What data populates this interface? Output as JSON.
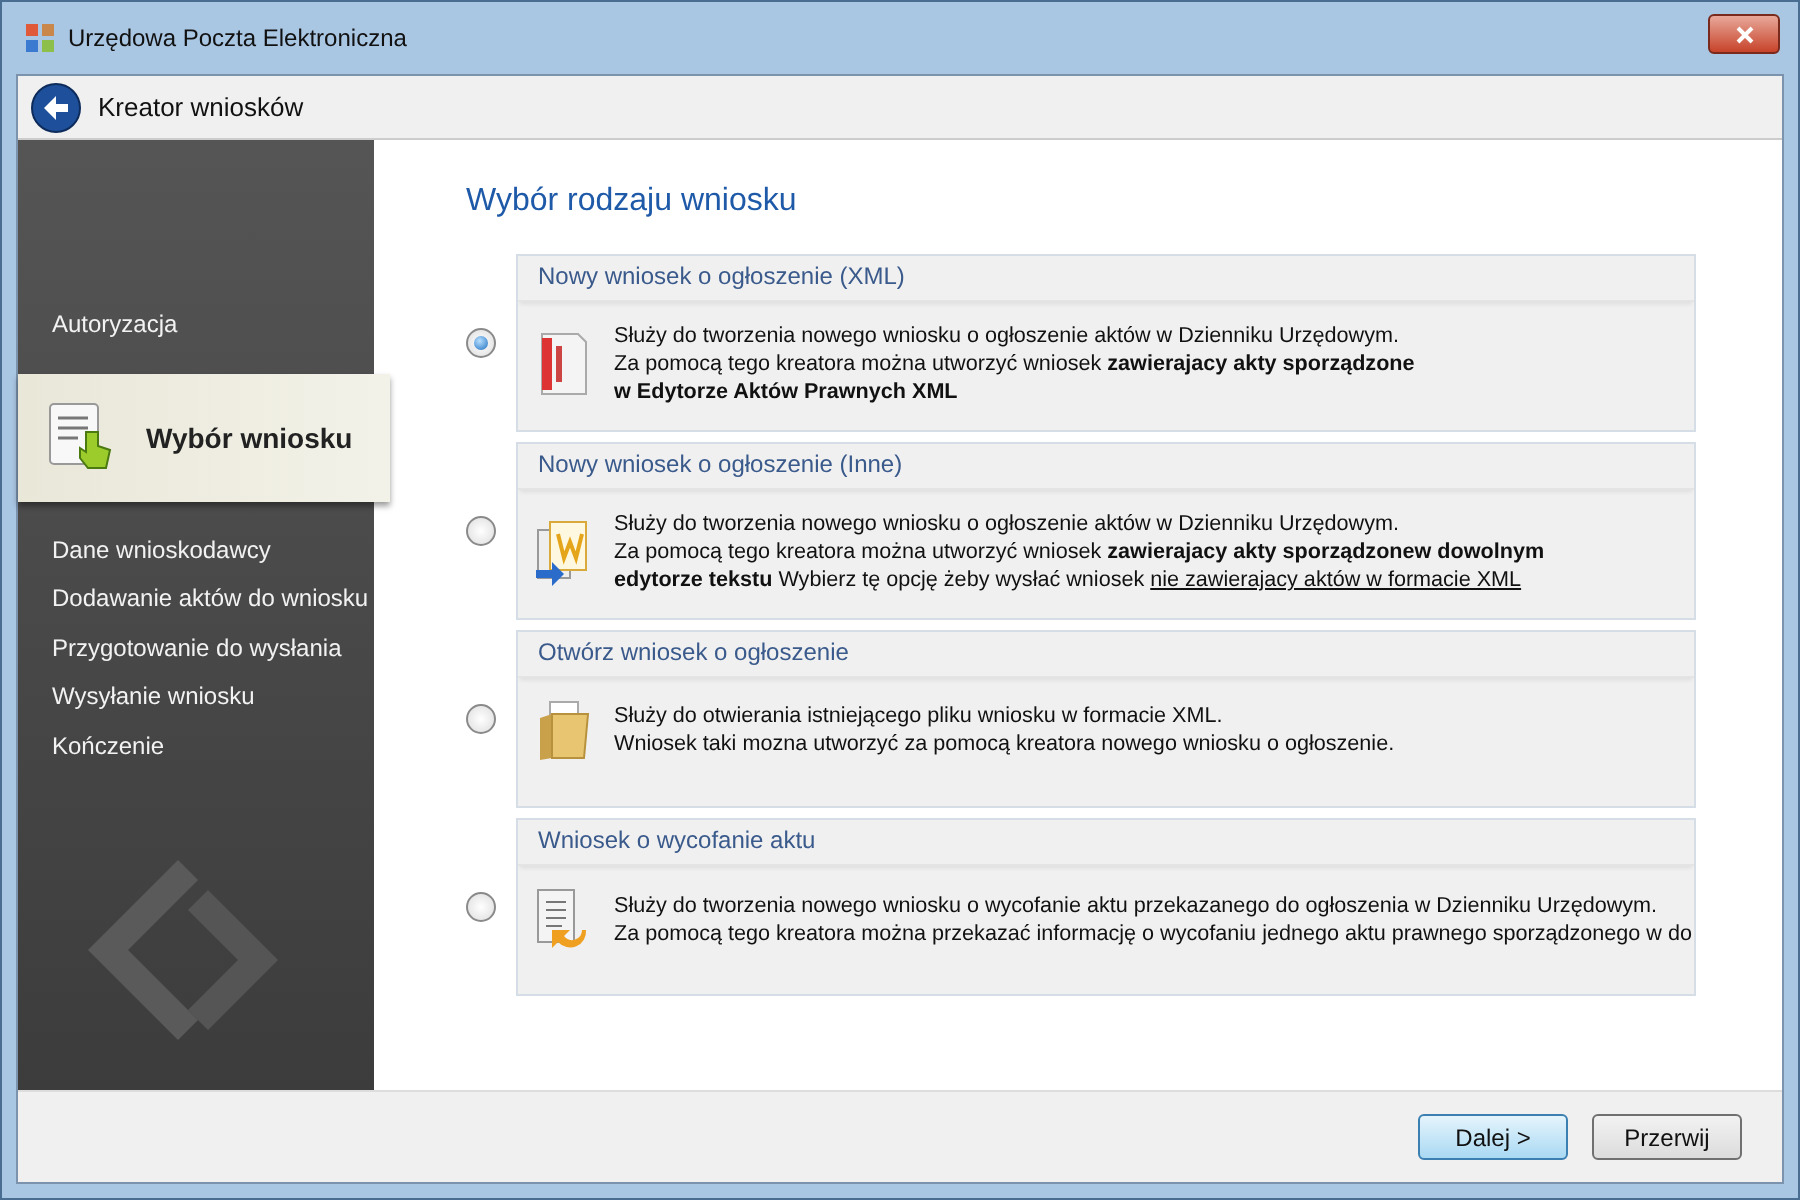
{
  "window": {
    "title": "Urzędowa Poczta Elektroniczna"
  },
  "header": {
    "title": "Kreator wniosków"
  },
  "sidebar": {
    "items": [
      {
        "label": "Autoryzacja",
        "selected": false
      },
      {
        "label": "Wybór wniosku",
        "selected": true
      },
      {
        "label": "Dane wnioskodawcy",
        "selected": false
      },
      {
        "label": "Dodawanie aktów do wniosku",
        "selected": false
      },
      {
        "label": "Przygotowanie do wysłania",
        "selected": false
      },
      {
        "label": "Wysyłanie wniosku",
        "selected": false
      },
      {
        "label": "Kończenie",
        "selected": false
      }
    ]
  },
  "page": {
    "title": "Wybór rodzaju wniosku",
    "options": [
      {
        "title": "Nowy wniosek o ogłoszenie (XML)",
        "selected": true,
        "lines": [
          [
            {
              "kind": "text",
              "text": "Służy do tworzenia nowego wniosku o ogłoszenie aktów w Dzienniku Urzędowym."
            }
          ],
          [
            {
              "kind": "text",
              "text": "Za pomocą tego kreatora można utworzyć wniosek **zawierajacy akty sporządzone**"
            }
          ],
          [
            {
              "kind": "text",
              "text": "**w Edytorze Aktów Prawnych XML**"
            }
          ]
        ]
      },
      {
        "title": "Nowy wniosek o ogłoszenie (Inne)",
        "selected": false,
        "lines": [
          [
            {
              "kind": "text",
              "text": "Służy do tworzenia nowego wniosku o ogłoszenie aktów w Dzienniku Urzędowym."
            }
          ],
          [
            {
              "kind": "text",
              "text": "Za pomocą tego kreatora można utworzyć wniosek **zawierajacy akty sporządzonew dowolnym**"
            }
          ],
          [
            {
              "kind": "text",
              "text": "**edytorze tekstu** Wybierz tę opcję żeby wysłać wniosek "
            },
            {
              "kind": "link",
              "text": "nie zawierajacy aktów w formacie XML"
            }
          ]
        ]
      },
      {
        "title": "Otwórz wniosek o ogłoszenie",
        "selected": false,
        "lines": [
          [
            {
              "kind": "text",
              "text": "Służy do otwierania istniejącego pliku wniosku w formacie XML."
            }
          ],
          [
            {
              "kind": "text",
              "text": "Wniosek taki mozna utworzyć za pomocą kreatora nowego wniosku o ogłoszenie."
            }
          ]
        ]
      },
      {
        "title": "Wniosek o wycofanie aktu",
        "selected": false,
        "lines": [
          [
            {
              "kind": "text",
              "text": "Służy do tworzenia nowego wniosku o wycofanie aktu przekazanego do ogłoszenia w Dzienniku Urzędowym."
            }
          ],
          [
            {
              "kind": "text",
              "text": "Za pomocą tego kreatora można przekazać informację o wycofaniu jednego aktu prawnego sporządzonego w do"
            }
          ]
        ]
      }
    ]
  },
  "buttons": [
    {
      "label": "Dalej >",
      "default": true
    },
    {
      "label": "Przerwij",
      "default": false
    }
  ]
}
